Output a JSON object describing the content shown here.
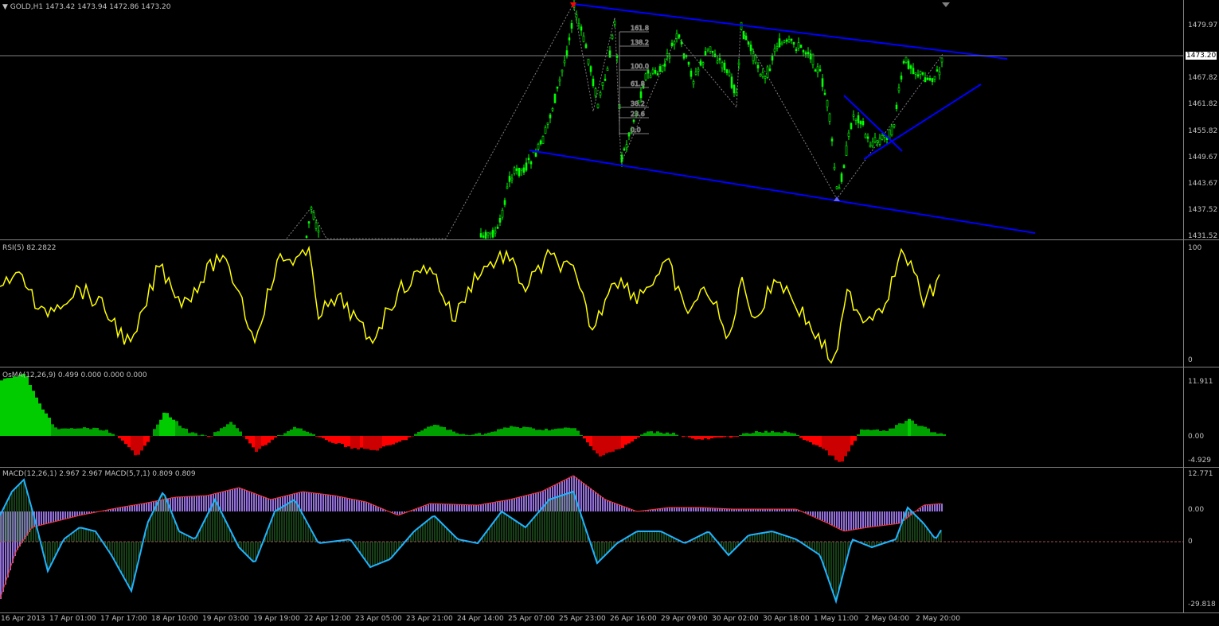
{
  "main": {
    "title": "GOLD,H1",
    "ohlc": "1473.42 1473.94 1472.86 1473.20",
    "current_price": "1473.20",
    "price_axis": [
      "1479.97",
      "1467.82",
      "1461.82",
      "1455.82",
      "1449.67",
      "1443.67",
      "1437.52",
      "1431.52"
    ],
    "fib_levels": [
      "161.8",
      "138.2",
      "100.0",
      "61.8",
      "38.2",
      "23.6",
      "0.0"
    ],
    "colors": {
      "bull": "#00ff00",
      "bear": "#00ff00",
      "channel": "#0000ff",
      "zigzag": "#808080",
      "bg": "#000000"
    }
  },
  "rsi": {
    "title": "RSI(5) 82.2822",
    "axis_top": "100",
    "axis_bottom": "0",
    "color": "#ffff00"
  },
  "osma": {
    "title": "OsMA(12,26,9) 0.499 0.000 0.000 0.000",
    "axis": [
      "11.911",
      "0.00",
      "-4.929"
    ],
    "pos_color": "#00ff00",
    "neg_color": "#ff0000"
  },
  "macd": {
    "title": "MACD(12,26,1) 2.967 2.967  MACD(5,7,1) 0.809 0.809",
    "axis": [
      "12.771",
      "0.00",
      "0",
      "-29.818"
    ],
    "hist_color": "#9370db",
    "line_color": "#1fb3ff"
  },
  "time_axis": [
    "16 Apr 2013",
    "17 Apr 01:00",
    "17 Apr 17:00",
    "18 Apr 10:00",
    "19 Apr 03:00",
    "19 Apr 19:00",
    "22 Apr 12:00",
    "23 Apr 05:00",
    "23 Apr 21:00",
    "24 Apr 14:00",
    "25 Apr 07:00",
    "25 Apr 23:00",
    "26 Apr 16:00",
    "29 Apr 09:00",
    "30 Apr 02:00",
    "30 Apr 18:00",
    "1 May 11:00",
    "2 May 04:00",
    "2 May 20:00"
  ]
}
